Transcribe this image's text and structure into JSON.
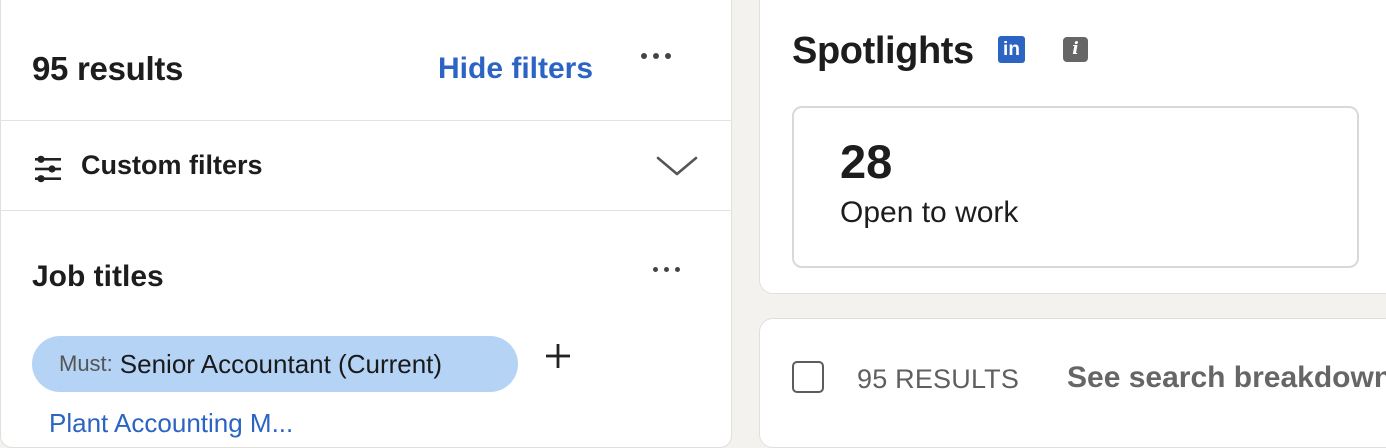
{
  "filters_panel": {
    "results_count": "95 results",
    "hide_filters_label": "Hide filters",
    "custom_filters_label": "Custom filters",
    "job_titles": {
      "heading": "Job titles",
      "chips": [
        {
          "prefix": "Must:",
          "value": "Senior Accountant (Current)"
        }
      ],
      "next_item_partial": "Plant Accounting M..."
    }
  },
  "spotlights": {
    "title": "Spotlights",
    "linkedin_badge": "in",
    "info_badge": "i",
    "cards": [
      {
        "number": "28",
        "label": "Open to work"
      }
    ]
  },
  "results_bar": {
    "count_label": "95 RESULTS",
    "breakdown_link": "See search breakdown"
  },
  "colors": {
    "accent_blue": "#2b64c3",
    "chip_background": "#b4d3f5",
    "page_background": "#f3f2ef"
  }
}
